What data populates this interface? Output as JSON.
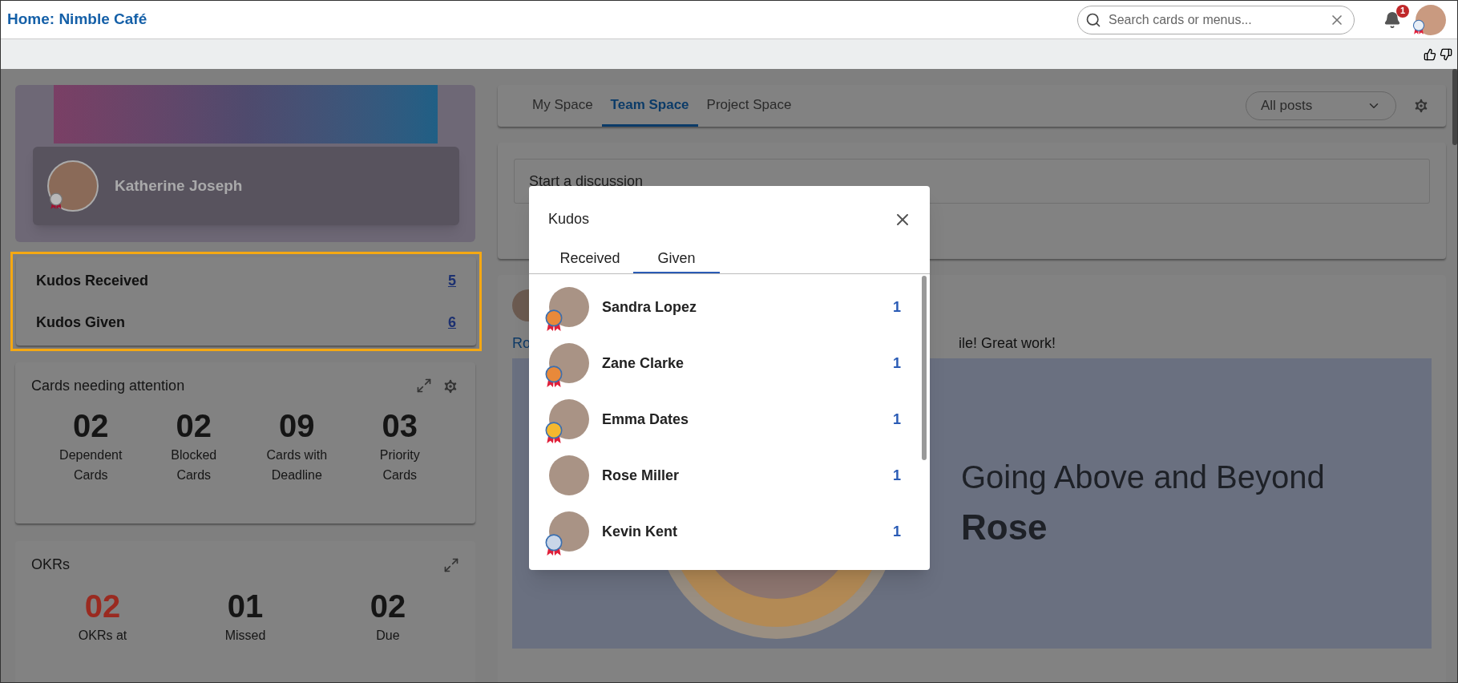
{
  "header": {
    "title": "Home: Nimble Café",
    "search": {
      "placeholder": "Search cards or menus..."
    },
    "notifications": "1"
  },
  "profile": {
    "name": "Katherine Joseph"
  },
  "kudos_summary": [
    {
      "label": "Kudos Received",
      "count": "5"
    },
    {
      "label": "Kudos Given",
      "count": "6"
    }
  ],
  "cards_attention": {
    "title": "Cards needing attention",
    "stats": [
      {
        "value": "02",
        "label": "Dependent Cards",
        "alert": false
      },
      {
        "value": "02",
        "label": "Blocked Cards",
        "alert": false
      },
      {
        "value": "09",
        "label": "Cards with Deadline",
        "alert": false
      },
      {
        "value": "03",
        "label": "Priority Cards",
        "alert": false
      }
    ]
  },
  "okrs": {
    "title": "OKRs",
    "stats": [
      {
        "value": "02",
        "label": "OKRs at",
        "alert": true
      },
      {
        "value": "01",
        "label": "Missed",
        "alert": false
      },
      {
        "value": "02",
        "label": "Due",
        "alert": false
      }
    ]
  },
  "space_tabs": [
    {
      "label": "My Space",
      "selected": false
    },
    {
      "label": "Team Space",
      "selected": true
    },
    {
      "label": "Project Space",
      "selected": false
    }
  ],
  "filter": {
    "value": "All posts"
  },
  "discussion": {
    "placeholder": "Start a discussion"
  },
  "post": {
    "author": "Ro",
    "text": "ile! Great work!",
    "banner_title": "Going Above and Beyond",
    "banner_name": "Rose"
  },
  "kudos_dialog": {
    "title": "Kudos",
    "tabs": [
      {
        "label": "Received",
        "selected": false
      },
      {
        "label": "Given",
        "selected": true
      }
    ],
    "people": [
      {
        "name": "Sandra Lopez",
        "count": "1",
        "color": "#e8893a"
      },
      {
        "name": "Zane Clarke",
        "count": "1",
        "color": "#e8893a"
      },
      {
        "name": "Emma Dates",
        "count": "1",
        "color": "#f5b82e"
      },
      {
        "name": "Rose Miller",
        "count": "1"
      },
      {
        "name": "Kevin Kent",
        "count": "1",
        "color": "#c9d6e8"
      }
    ]
  }
}
